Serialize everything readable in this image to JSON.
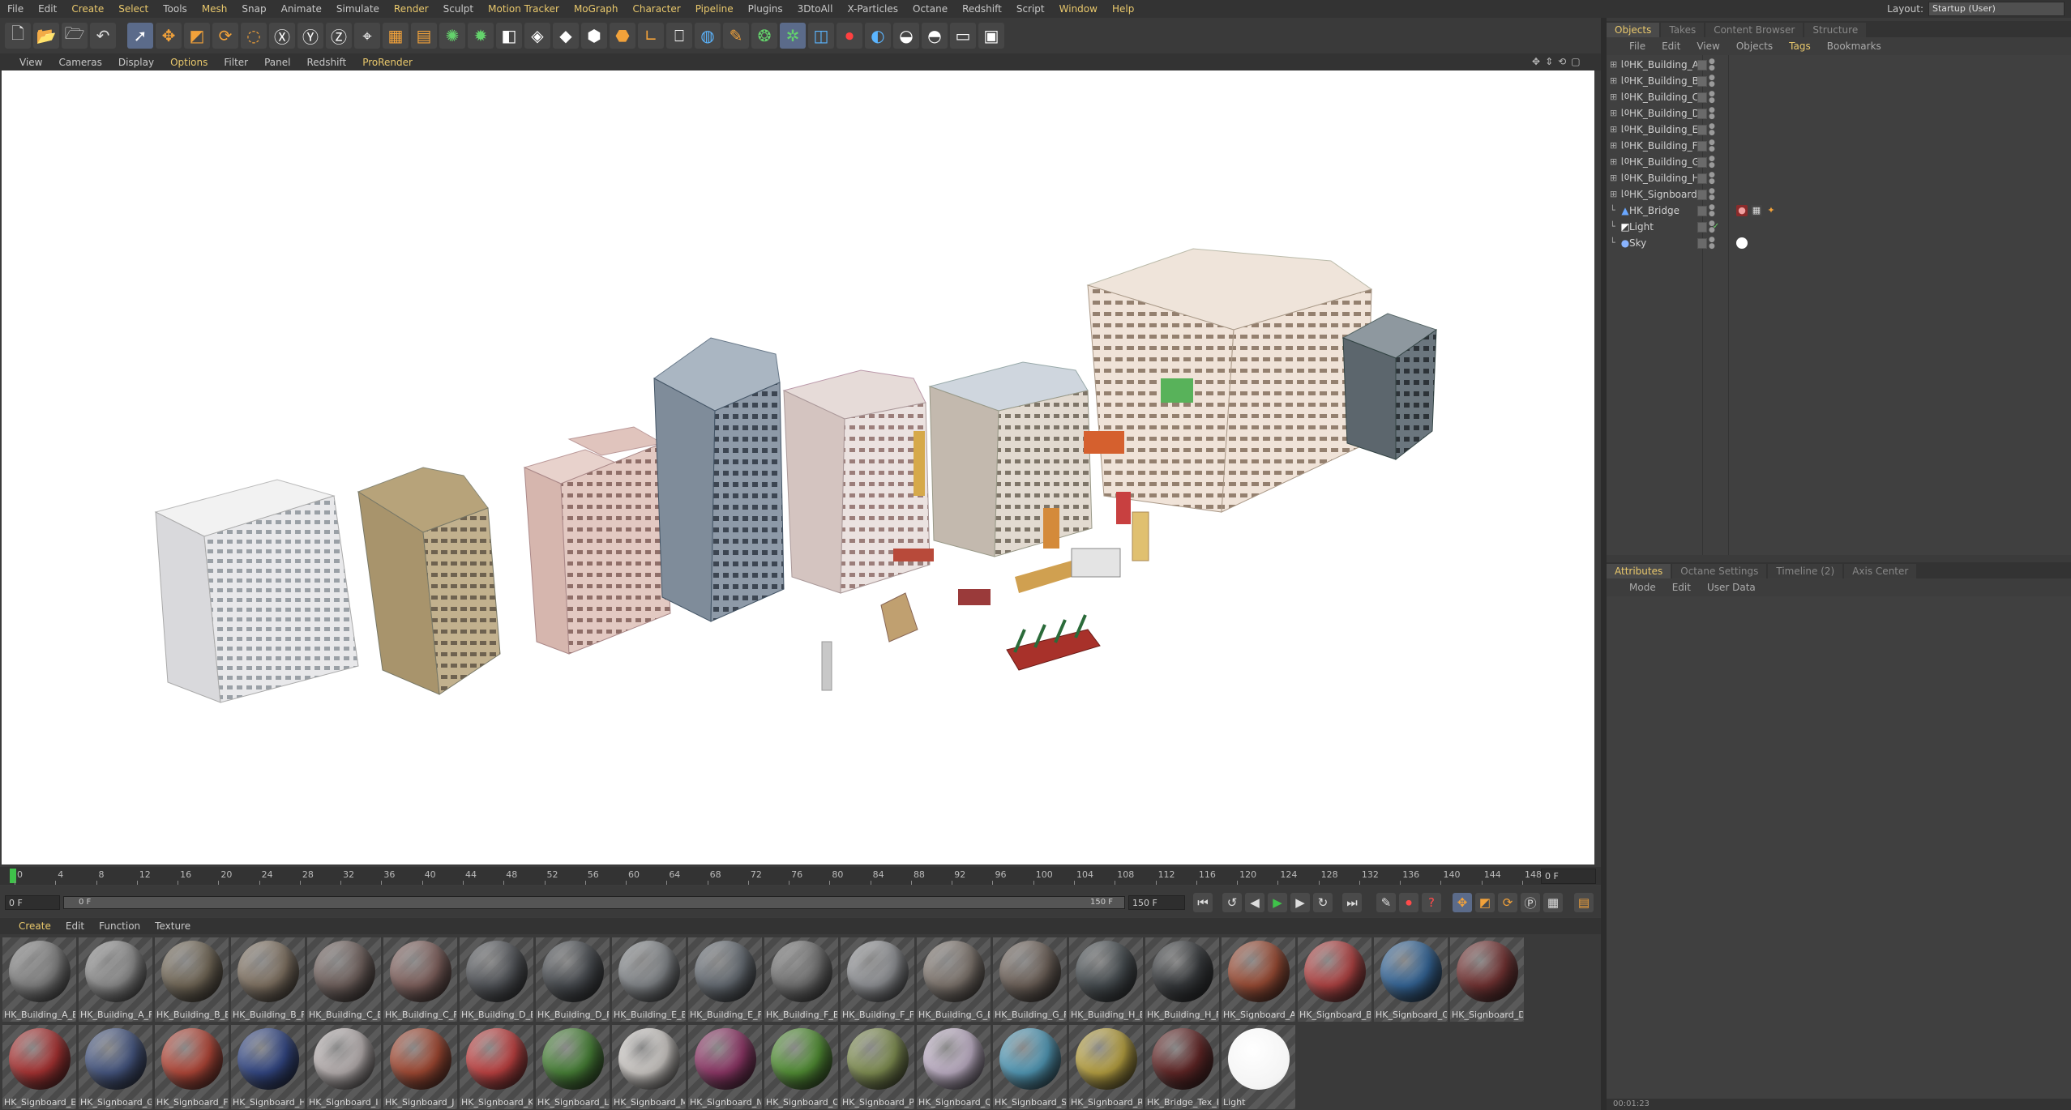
{
  "menubar": {
    "items": [
      "File",
      "Edit",
      "Create",
      "Select",
      "Tools",
      "Mesh",
      "Snap",
      "Animate",
      "Simulate",
      "Render",
      "Sculpt",
      "Motion Tracker",
      "MoGraph",
      "Character",
      "Pipeline",
      "Plugins",
      "3DtoAll",
      "X-Particles",
      "Octane",
      "Redshift",
      "Script",
      "Window",
      "Help"
    ],
    "layout_label": "Layout:",
    "layout_value": "Startup (User)"
  },
  "viewport": {
    "menu": [
      "View",
      "Cameras",
      "Display",
      "Options",
      "Filter",
      "Panel",
      "Redshift",
      "ProRender"
    ],
    "background_color": "#ffffff"
  },
  "timeline": {
    "ticks": [
      "0",
      "4",
      "8",
      "12",
      "16",
      "20",
      "24",
      "28",
      "32",
      "36",
      "40",
      "44",
      "48",
      "52",
      "56",
      "60",
      "64",
      "68",
      "72",
      "76",
      "80",
      "84",
      "88",
      "92",
      "96",
      "100",
      "104",
      "108",
      "112",
      "116",
      "120",
      "124",
      "128",
      "132",
      "136",
      "140",
      "144",
      "148"
    ],
    "end_field": "0 F",
    "current_frame": "0 F",
    "range_start": "0 F",
    "range_end": "150 F",
    "max_field": "150 F"
  },
  "material_manager": {
    "menu": [
      "Create",
      "Edit",
      "Function",
      "Texture"
    ],
    "materials": [
      {
        "name": "HK_Building_A_B",
        "color": "#8d8d8d"
      },
      {
        "name": "HK_Building_A_F",
        "color": "#9a9a9a"
      },
      {
        "name": "HK_Building_B_B",
        "color": "#7d7260"
      },
      {
        "name": "HK_Building_B_F",
        "color": "#8c7d6c"
      },
      {
        "name": "HK_Building_C_B",
        "color": "#7a6a66"
      },
      {
        "name": "HK_Building_C_F",
        "color": "#8b6a66"
      },
      {
        "name": "HK_Building_D_B",
        "color": "#5a5d62"
      },
      {
        "name": "HK_Building_D_F",
        "color": "#4f5358"
      },
      {
        "name": "HK_Building_E_B",
        "color": "#8e9296"
      },
      {
        "name": "HK_Building_E_F",
        "color": "#6f767e"
      },
      {
        "name": "HK_Building_F_B",
        "color": "#7b7b7b"
      },
      {
        "name": "HK_Building_F_F",
        "color": "#9c9ea2"
      },
      {
        "name": "HK_Building_G_B",
        "color": "#8a8078"
      },
      {
        "name": "HK_Building_G_F",
        "color": "#786b62"
      },
      {
        "name": "HK_Building_H_B",
        "color": "#4d5458"
      },
      {
        "name": "HK_Building_H_F",
        "color": "#3c3f42"
      },
      {
        "name": "HK_Signboard_A",
        "color": "#a8533a"
      },
      {
        "name": "HK_Signboard_B",
        "color": "#c04a4a"
      },
      {
        "name": "HK_Signboard_C",
        "color": "#3a6fa5"
      },
      {
        "name": "HK_Signboard_D",
        "color": "#7d3838"
      },
      {
        "name": "HK_Signboard_E",
        "color": "#b83838"
      },
      {
        "name": "HK_Signboard_G",
        "color": "#4c5e8c"
      },
      {
        "name": "HK_Signboard_F",
        "color": "#c24e3e"
      },
      {
        "name": "HK_Signboard_H",
        "color": "#384e90"
      },
      {
        "name": "HK_Signboard_I",
        "color": "#c8c0c0"
      },
      {
        "name": "HK_Signboard_J",
        "color": "#b05038"
      },
      {
        "name": "HK_Signboard_K",
        "color": "#d04848"
      },
      {
        "name": "HK_Signboard_L",
        "color": "#4e8c3c"
      },
      {
        "name": "HK_Signboard_M",
        "color": "#e0dcd8"
      },
      {
        "name": "HK_Signboard_N",
        "color": "#9a3c70"
      },
      {
        "name": "HK_Signboard_O",
        "color": "#5a9c3a"
      },
      {
        "name": "HK_Signboard_P",
        "color": "#8c9c5a"
      },
      {
        "name": "HK_Signboard_Q",
        "color": "#d0c0d8"
      },
      {
        "name": "HK_Signboard_S",
        "color": "#5aa8c8"
      },
      {
        "name": "HK_Signboard_R",
        "color": "#c8b048"
      },
      {
        "name": "HK_Bridge_Tex_F",
        "color": "#6a2a2a"
      },
      {
        "name": "Light",
        "color": "#ffffff"
      }
    ]
  },
  "object_manager": {
    "tabs": [
      "Objects",
      "Takes",
      "Content Browser",
      "Structure"
    ],
    "menu": [
      "File",
      "Edit",
      "View",
      "Objects",
      "Tags",
      "Bookmarks"
    ],
    "objects": [
      {
        "name": "HK_Building_A",
        "icon": "null-icon"
      },
      {
        "name": "HK_Building_B",
        "icon": "null-icon"
      },
      {
        "name": "HK_Building_C",
        "icon": "null-icon"
      },
      {
        "name": "HK_Building_D",
        "icon": "null-icon"
      },
      {
        "name": "HK_Building_E",
        "icon": "null-icon"
      },
      {
        "name": "HK_Building_F",
        "icon": "null-icon"
      },
      {
        "name": "HK_Building_G",
        "icon": "null-icon"
      },
      {
        "name": "HK_Building_H",
        "icon": "null-icon"
      },
      {
        "name": "HK_Signboard",
        "icon": "null-icon"
      },
      {
        "name": "HK_Bridge",
        "icon": "polygon-icon"
      },
      {
        "name": "Light",
        "icon": "light-icon"
      },
      {
        "name": "Sky",
        "icon": "sky-icon"
      }
    ]
  },
  "attribute_manager": {
    "tabs": [
      "Attributes",
      "Octane Settings",
      "Timeline (2)",
      "Axis Center"
    ],
    "menu": [
      "Mode",
      "Edit",
      "User Data"
    ]
  },
  "status": {
    "text": "00:01:23"
  }
}
